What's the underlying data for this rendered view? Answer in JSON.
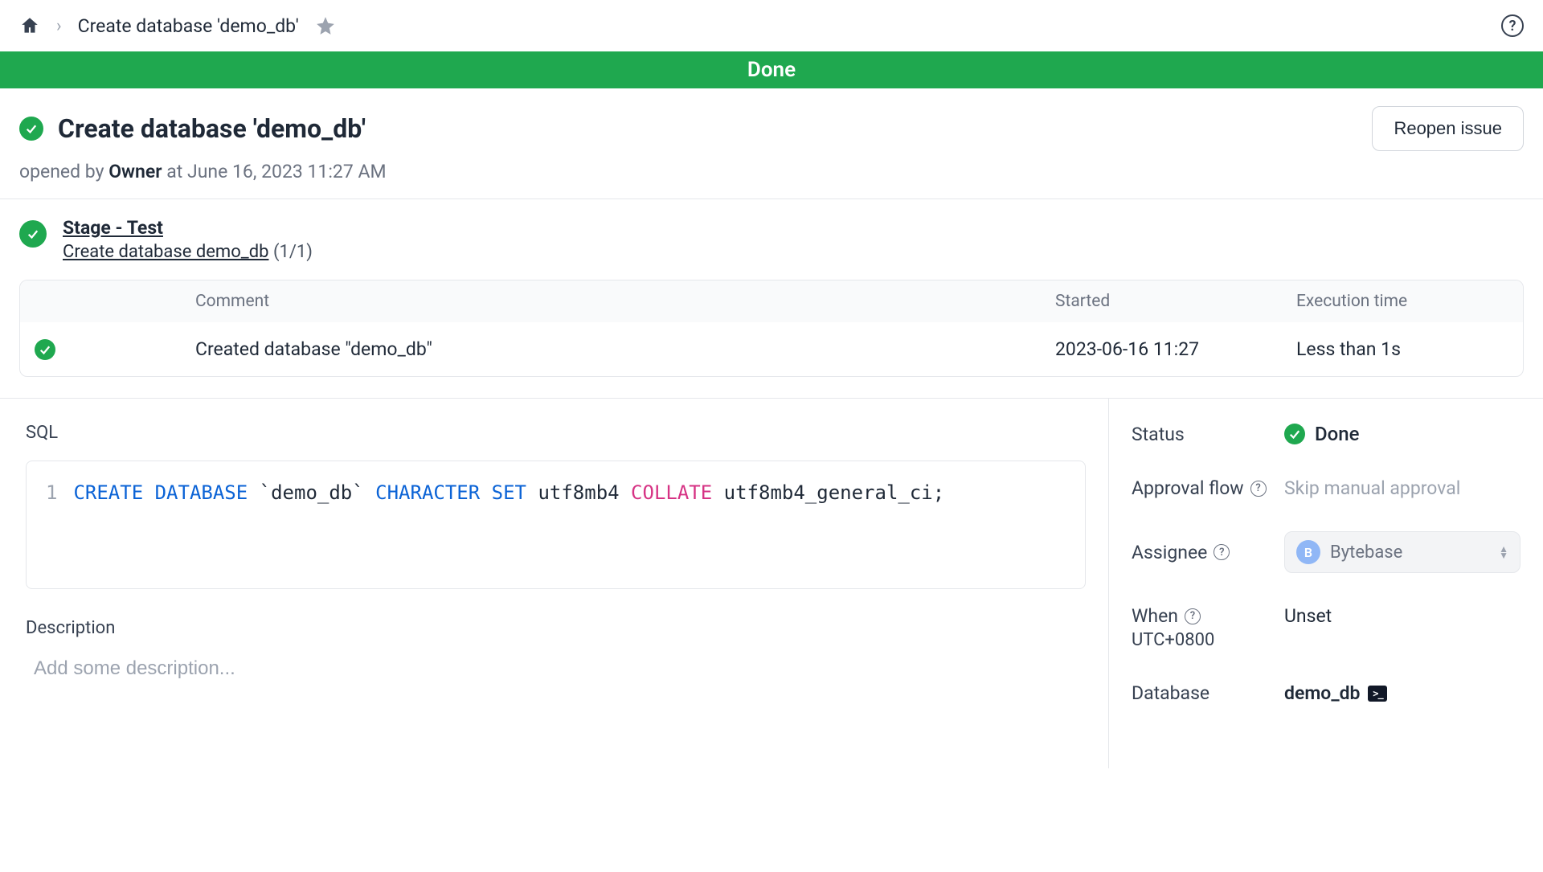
{
  "breadcrumb": {
    "title": "Create database 'demo_db'"
  },
  "banner": {
    "text": "Done"
  },
  "header": {
    "title": "Create database 'demo_db'",
    "reopen_label": "Reopen issue",
    "opened_by_prefix": "opened by",
    "opened_by_user": "Owner",
    "opened_by_at": "at",
    "opened_at": "June 16, 2023 11:27 AM"
  },
  "stage": {
    "name": "Stage - Test",
    "task": "Create database demo_db",
    "count": "(1/1)"
  },
  "table": {
    "headers": {
      "comment": "Comment",
      "started": "Started",
      "exec": "Execution time"
    },
    "rows": [
      {
        "comment": "Created database \"demo_db\"",
        "started": "2023-06-16 11:27",
        "exec": "Less than 1s"
      }
    ]
  },
  "sql": {
    "label": "SQL",
    "gutter": "1",
    "kw_create": "CREATE DATABASE",
    "dbname": " `demo_db` ",
    "kw_charset": "CHARACTER SET",
    "charset_val": " utf8mb4 ",
    "kw_collate": "COLLATE",
    "collate_val": " utf8mb4_general_ci;"
  },
  "description": {
    "label": "Description",
    "placeholder": "Add some description..."
  },
  "sidebar": {
    "status_label": "Status",
    "status_value": "Done",
    "approval_label": "Approval flow",
    "approval_value": "Skip manual approval",
    "assignee_label": "Assignee",
    "assignee_value": "Bytebase",
    "assignee_initial": "B",
    "when_label": "When",
    "when_tz": "UTC+0800",
    "when_value": "Unset",
    "database_label": "Database",
    "database_value": "demo_db"
  }
}
